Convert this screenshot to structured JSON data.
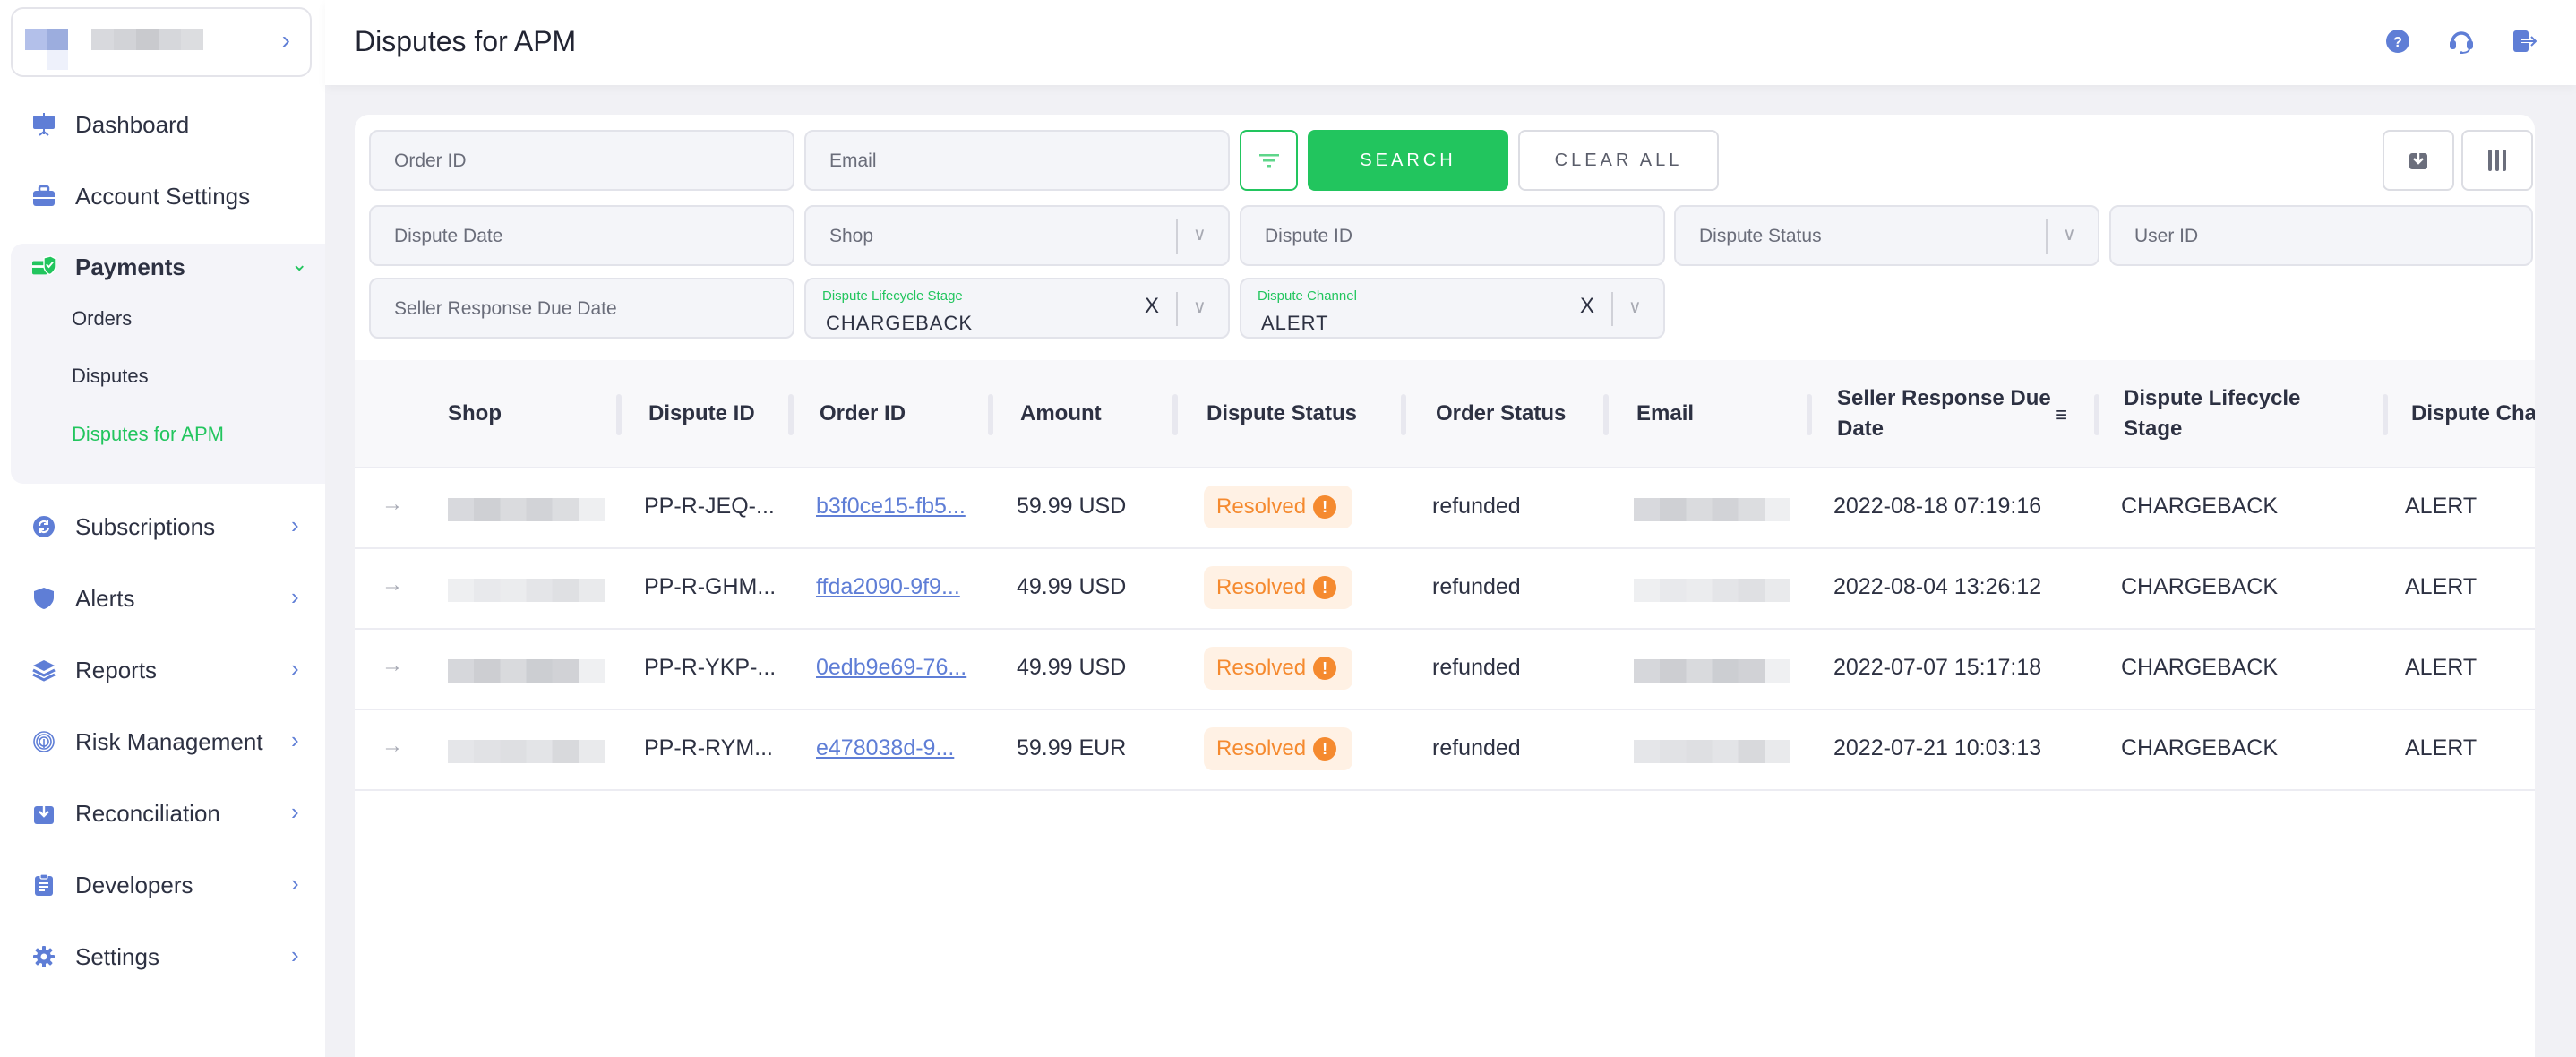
{
  "sidebar": {
    "account_chevron": "›",
    "items": [
      {
        "label": "Dashboard",
        "icon": "presentation-board-icon"
      },
      {
        "label": "Account Settings",
        "icon": "briefcase-icon"
      },
      {
        "label": "Payments",
        "icon": "payment-check-icon",
        "expanded": true,
        "children": [
          {
            "label": "Orders"
          },
          {
            "label": "Disputes"
          },
          {
            "label": "Disputes for APM",
            "active": true
          }
        ]
      },
      {
        "label": "Subscriptions",
        "icon": "refresh-circle-icon"
      },
      {
        "label": "Alerts",
        "icon": "shield-icon"
      },
      {
        "label": "Reports",
        "icon": "layers-icon"
      },
      {
        "label": "Risk Management",
        "icon": "fingerprint-icon"
      },
      {
        "label": "Reconciliation",
        "icon": "download-box-icon"
      },
      {
        "label": "Developers",
        "icon": "clipboard-icon"
      },
      {
        "label": "Settings",
        "icon": "gear-icon"
      }
    ]
  },
  "header": {
    "title": "Disputes for APM",
    "icons": [
      "help-icon",
      "headset-icon",
      "logout-icon"
    ]
  },
  "filters": {
    "order_id": {
      "placeholder": "Order ID",
      "value": ""
    },
    "email": {
      "placeholder": "Email",
      "value": ""
    },
    "search_label": "SEARCH",
    "clear_label": "CLEAR ALL",
    "dispute_date": {
      "placeholder": "Dispute Date"
    },
    "shop": {
      "placeholder": "Shop"
    },
    "dispute_id": {
      "placeholder": "Dispute ID"
    },
    "dispute_status": {
      "placeholder": "Dispute Status"
    },
    "user_id": {
      "placeholder": "User ID"
    },
    "seller_response_due_date": {
      "placeholder": "Seller Response Due Date"
    },
    "dispute_lifecycle_stage": {
      "label": "Dispute Lifecycle Stage",
      "value": "CHARGEBACK"
    },
    "dispute_channel": {
      "label": "Dispute Channel",
      "value": "ALERT"
    },
    "clear_glyph": "X"
  },
  "table": {
    "columns": [
      "Shop",
      "Dispute ID",
      "Order ID",
      "Amount",
      "Dispute Status",
      "Order Status",
      "Email",
      "Seller Response Due Date",
      "Dispute Lifecycle Stage",
      "Dispute Cha"
    ],
    "rows": [
      {
        "dispute_id": "PP-R-JEQ-...",
        "order_id": "b3f0ce15-fb5...",
        "amount": "59.99 USD",
        "dispute_status": "Resolved",
        "order_status": "refunded",
        "seller_response_due_date": "2022-08-18 07:19:16",
        "lifecycle_stage": "CHARGEBACK",
        "channel": "ALERT"
      },
      {
        "dispute_id": "PP-R-GHM...",
        "order_id": "ffda2090-9f9...",
        "amount": "49.99 USD",
        "dispute_status": "Resolved",
        "order_status": "refunded",
        "seller_response_due_date": "2022-08-04 13:26:12",
        "lifecycle_stage": "CHARGEBACK",
        "channel": "ALERT"
      },
      {
        "dispute_id": "PP-R-YKP-...",
        "order_id": "0edb9e69-76...",
        "amount": "49.99 USD",
        "dispute_status": "Resolved",
        "order_status": "refunded",
        "seller_response_due_date": "2022-07-07 15:17:18",
        "lifecycle_stage": "CHARGEBACK",
        "channel": "ALERT"
      },
      {
        "dispute_id": "PP-R-RYM...",
        "order_id": "e478038d-9...",
        "amount": "59.99 EUR",
        "dispute_status": "Resolved",
        "order_status": "refunded",
        "seller_response_due_date": "2022-07-21 10:03:13",
        "lifecycle_stage": "CHARGEBACK",
        "channel": "ALERT"
      }
    ]
  },
  "colors": {
    "accent_green": "#22c55e",
    "icon_blue": "#5f7ed6",
    "status_orange": "#f58a2f",
    "status_bg": "#fff1e4"
  }
}
